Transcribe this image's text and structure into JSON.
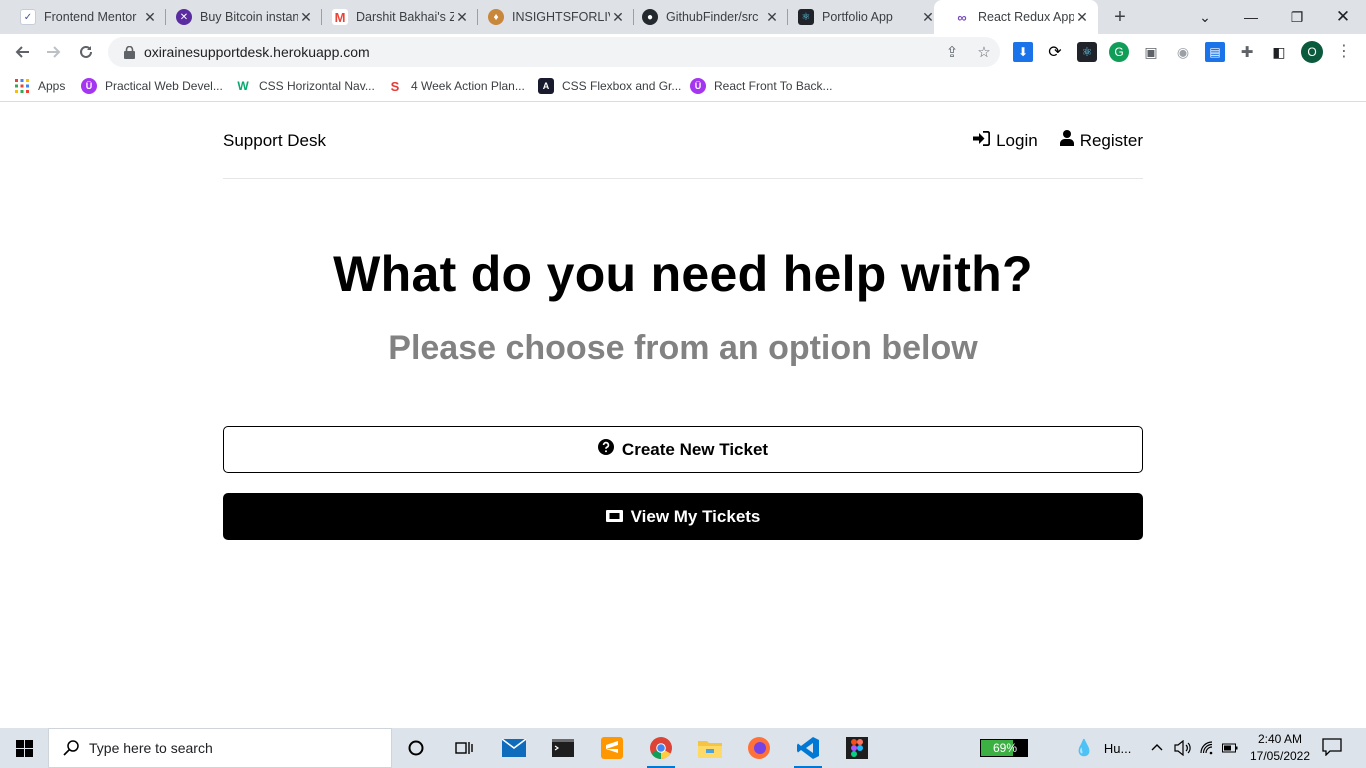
{
  "browser": {
    "tabs": [
      {
        "title": "Frontend Mentor",
        "icon": "frontend-mentor-icon",
        "color": "#3e54a3"
      },
      {
        "title": "Buy Bitcoin instantly",
        "icon": "bitcoin-icon",
        "color": "#5a2ca0"
      },
      {
        "title": "Darshit Bakhai's Zoom",
        "icon": "gmail-icon",
        "color": "#ea4335"
      },
      {
        "title": "INSIGHTSFORLIVING",
        "icon": "insights-icon",
        "color": "#8b5a2b"
      },
      {
        "title": "GithubFinder/src",
        "icon": "github-icon",
        "color": "#24292f"
      },
      {
        "title": "Portfolio App",
        "icon": "react-icon",
        "color": "#20232a"
      },
      {
        "title": "React Redux App",
        "icon": "redux-icon",
        "color": "#764abc"
      }
    ],
    "url": "oxirainesupportdesk.herokuapp.com",
    "profile_initial": "O",
    "bookmarks": [
      {
        "label": "Apps",
        "icon": "apps-grid-icon"
      },
      {
        "label": "Practical Web Devel...",
        "icon": "udemy-icon",
        "color": "#a435f0"
      },
      {
        "label": "CSS Horizontal Nav...",
        "icon": "w3schools-icon",
        "color": "#04aa6d"
      },
      {
        "label": "4 Week Action Plan...",
        "icon": "codecademy-icon",
        "color": "#e53935"
      },
      {
        "label": "CSS Flexbox and Gr...",
        "icon": "flexbox-icon",
        "color": "#1a1a2e"
      },
      {
        "label": "React Front To Back...",
        "icon": "udemy-icon",
        "color": "#a435f0"
      }
    ]
  },
  "site": {
    "logo": "Support Desk",
    "nav": {
      "login": "Login",
      "register": "Register"
    },
    "heading": "What do you need help with?",
    "subheading": "Please choose from an option below",
    "buttons": {
      "create": "Create New Ticket",
      "view": "View My Tickets"
    }
  },
  "taskbar": {
    "search_placeholder": "Type here to search",
    "battery_percent": "69%",
    "battery_level": 0.69,
    "tray_label": "Hu...",
    "time": "2:40 AM",
    "date": "17/05/2022"
  }
}
